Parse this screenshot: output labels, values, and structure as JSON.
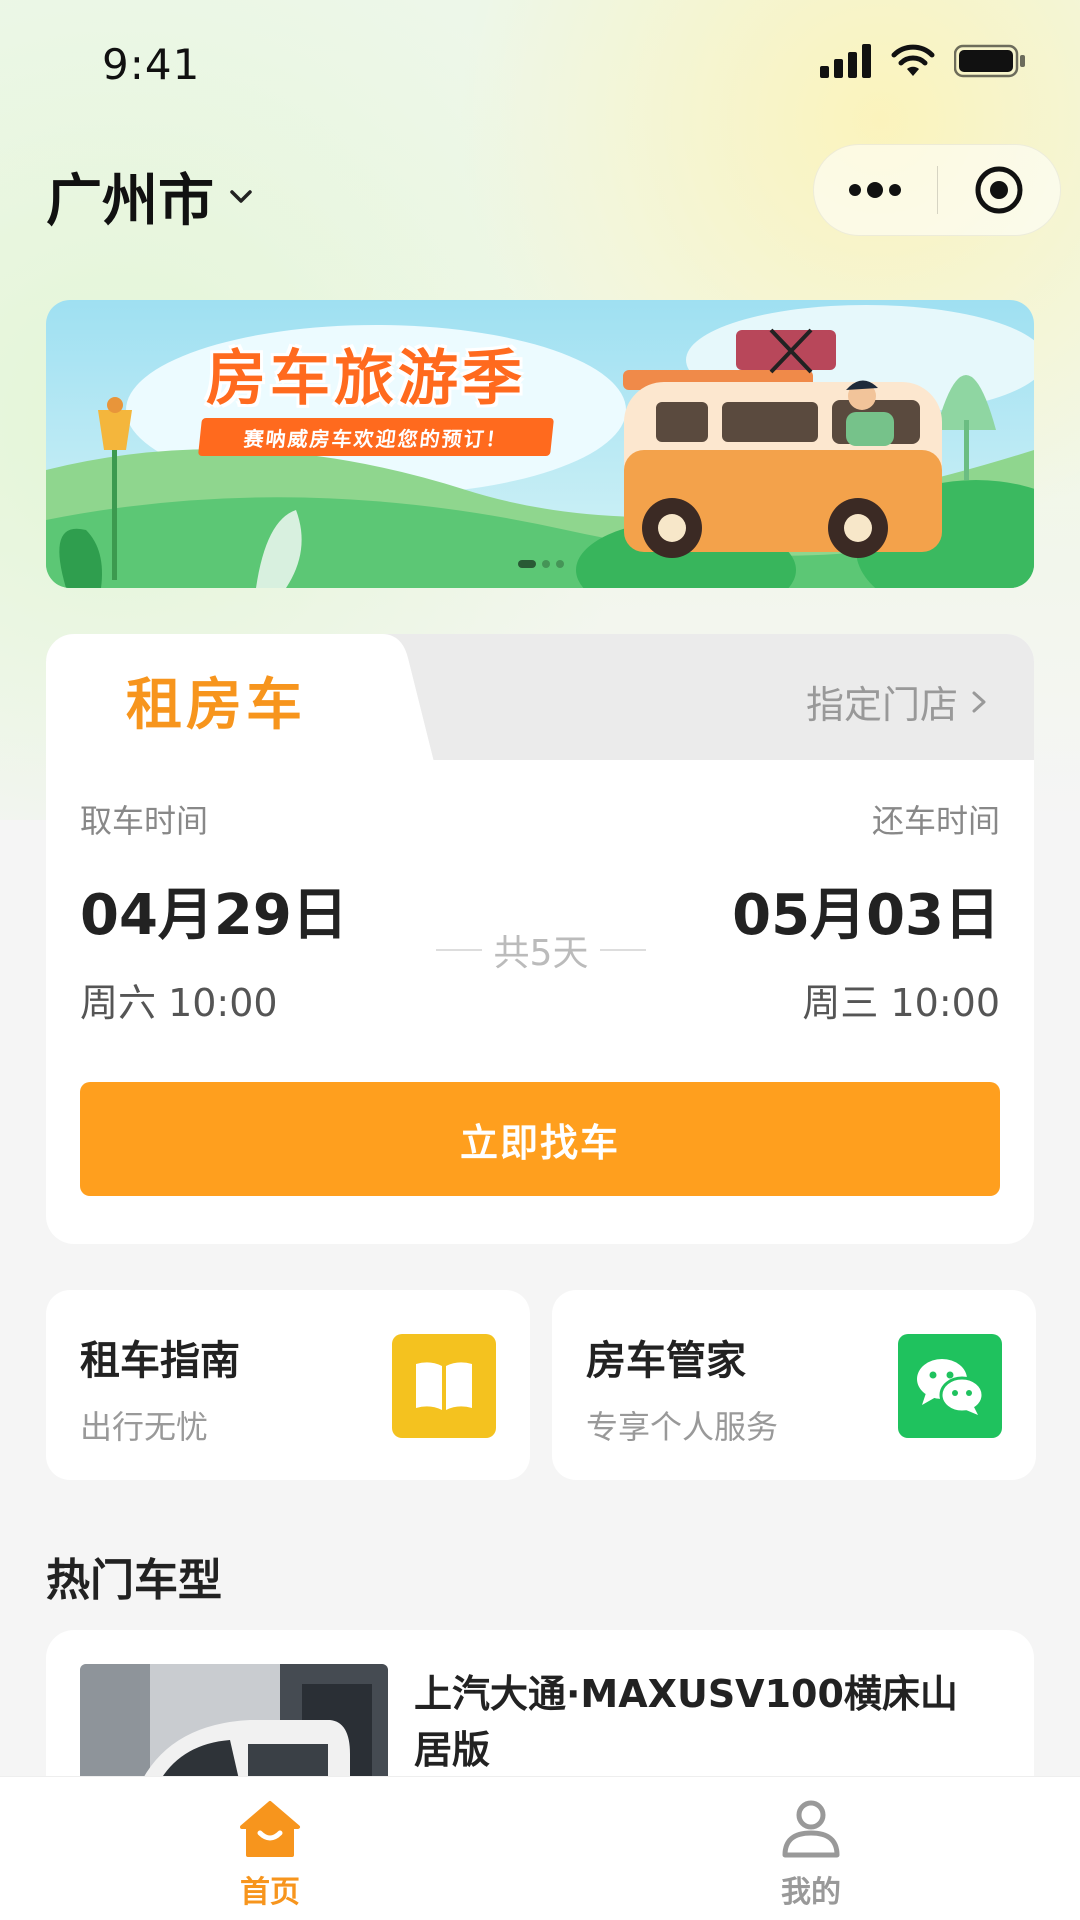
{
  "status_bar": {
    "time": "9:41"
  },
  "header": {
    "city": "广州市"
  },
  "banner": {
    "title": "房车旅游季",
    "subtitle": "赛呐威房车欢迎您的预订！",
    "slide_count": 3,
    "active_slide": 1
  },
  "rent_card": {
    "tab_active": "租房车",
    "tab_store": "指定门店",
    "pickup_label": "取车时间",
    "pickup_date": "04月29日",
    "pickup_time": "周六 10:00",
    "return_label": "还车时间",
    "return_date": "05月03日",
    "return_time": "周三 10:00",
    "days": "共5天",
    "search_button": "立即找车"
  },
  "features": [
    {
      "title": "租车指南",
      "subtitle": "出行无忧",
      "icon": "book-icon",
      "color": "#f4c21f"
    },
    {
      "title": "房车管家",
      "subtitle": "专享个人服务",
      "icon": "wechat-icon",
      "color": "#1fc25e"
    }
  ],
  "hot_models": {
    "title": "热门车型",
    "items": [
      {
        "name": "上汽大通·MAXUSV100横床山居版"
      }
    ]
  },
  "tabbar": {
    "items": [
      {
        "label": "首页",
        "icon": "home-icon",
        "active": true
      },
      {
        "label": "我的",
        "icon": "user-icon",
        "active": false
      }
    ]
  },
  "colors": {
    "accent": "#ff9f1e",
    "accent_text": "#f7951d",
    "inactive": "#999999"
  }
}
